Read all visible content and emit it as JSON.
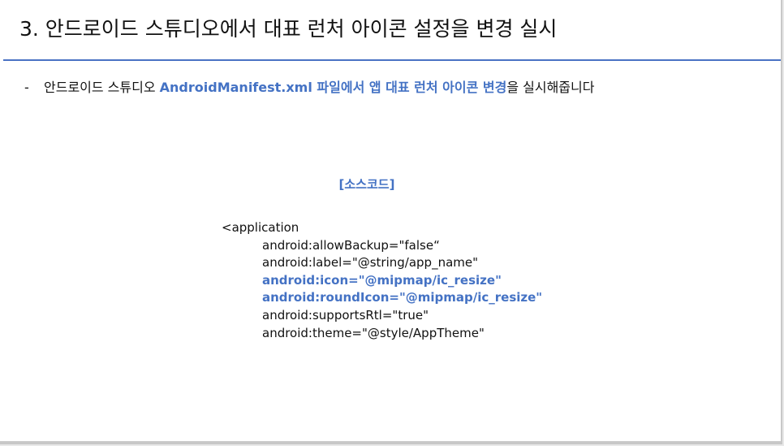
{
  "slide": {
    "title": "3. 안드로이드 스튜디오에서 대표 런처 아이콘 설정을 변경 실시",
    "bullet": {
      "dash": "-",
      "prefix": "안드로이드 스튜디오 ",
      "highlight": "AndroidManifest.xml 파일에서 앱 대표 런처 아이콘 변경",
      "suffix": "을 실시해줍니다"
    },
    "code_title": "[소스코드]",
    "code_lines": [
      "<application",
      "android:allowBackup=\"false“",
      "android:label=\"@string/app_name\"",
      "android:icon=\"@mipmap/ic_resize\"",
      "android:roundIcon=\"@mipmap/ic_resize\"",
      "android:supportsRtl=\"true\"",
      "android:theme=\"@style/AppTheme\""
    ]
  },
  "colors": {
    "accent": "#4472c4",
    "rule": "#4a72c4",
    "text": "#111111"
  }
}
